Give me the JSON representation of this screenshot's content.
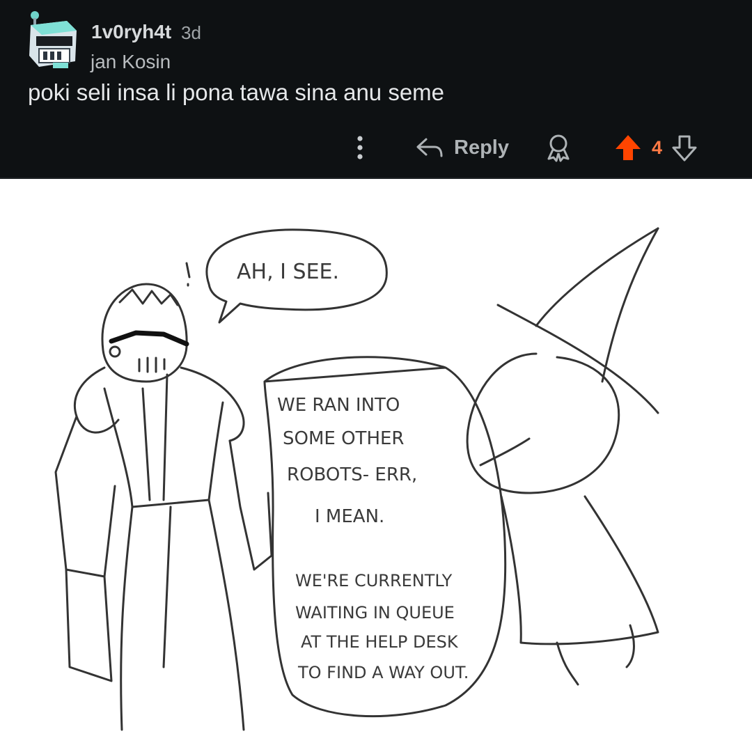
{
  "comment": {
    "username": "1v0ryh4t",
    "age": "3d",
    "flair": "jan Kosin",
    "body": "poki seli insa li pona tawa sina anu seme",
    "actions": {
      "reply_label": "Reply",
      "score": "4"
    }
  },
  "icons": {
    "avatar": "robot-avatar",
    "more": "more-vertical-icon",
    "reply": "reply-arrow-icon",
    "award": "award-icon",
    "upvote": "upvote-arrow-icon",
    "downvote": "downvote-arrow-icon"
  },
  "colors": {
    "background": "#0e1113",
    "upvote_active": "#ff4500",
    "score": "#ff7a45"
  },
  "comic": {
    "speech_top": "AH, I SEE.",
    "speech_main": [
      "WE RAN INTO",
      "SOME OTHER",
      "ROBOTS- ERR,",
      "I MEAN.",
      "WE'RE CURRENTLY",
      "WAITING IN QUEUE",
      "AT THE HELP DESK",
      "TO FIND A WAY OUT."
    ]
  }
}
